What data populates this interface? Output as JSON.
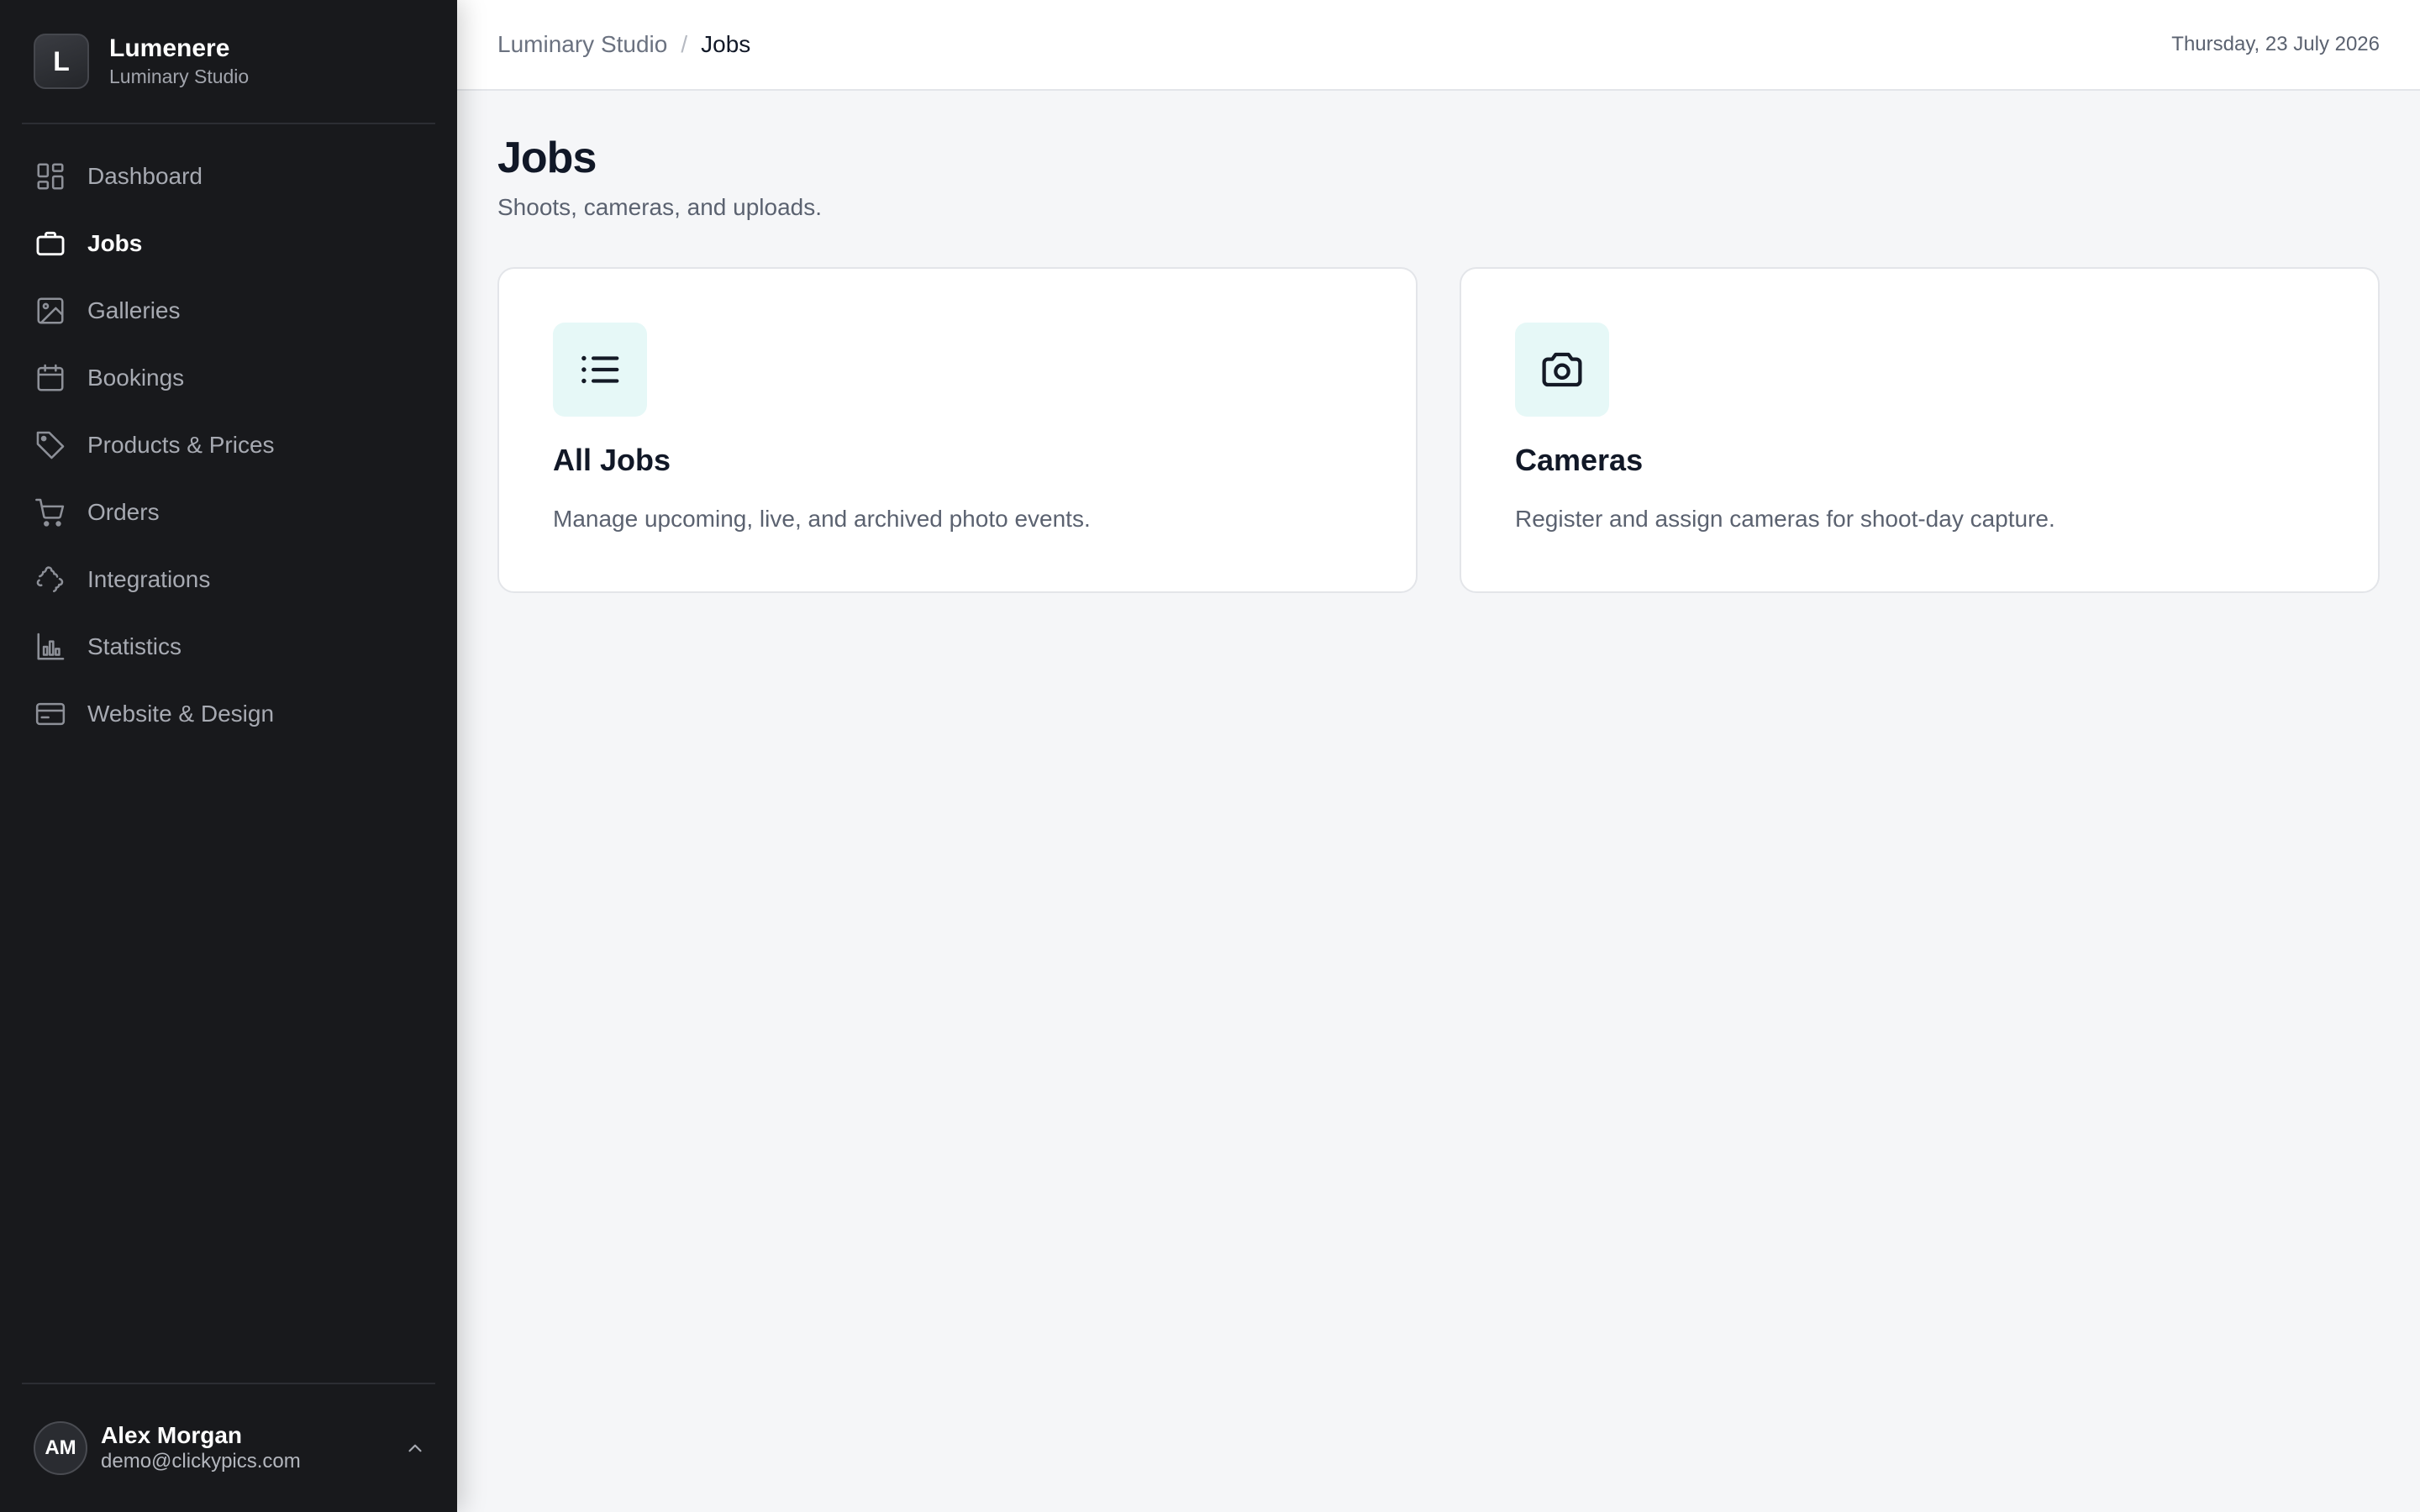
{
  "brand": {
    "logo_letter": "L",
    "name": "Lumenere",
    "subtitle": "Luminary Studio"
  },
  "sidebar": {
    "items": [
      {
        "label": "Dashboard",
        "icon": "dashboard-icon",
        "active": false
      },
      {
        "label": "Jobs",
        "icon": "briefcase-icon",
        "active": true
      },
      {
        "label": "Galleries",
        "icon": "image-icon",
        "active": false
      },
      {
        "label": "Bookings",
        "icon": "calendar-icon",
        "active": false
      },
      {
        "label": "Products & Prices",
        "icon": "tag-icon",
        "active": false
      },
      {
        "label": "Orders",
        "icon": "cart-icon",
        "active": false
      },
      {
        "label": "Integrations",
        "icon": "puzzle-icon",
        "active": false
      },
      {
        "label": "Statistics",
        "icon": "bar-chart-icon",
        "active": false
      },
      {
        "label": "Website & Design",
        "icon": "card-icon",
        "active": false
      }
    ]
  },
  "user": {
    "initials": "AM",
    "name": "Alex Morgan",
    "email": "demo@clickypics.com"
  },
  "header": {
    "breadcrumb_root": "Luminary Studio",
    "breadcrumb_separator": "/",
    "breadcrumb_current": "Jobs",
    "date": "Thursday, 23 July 2026"
  },
  "page": {
    "title": "Jobs",
    "subtitle": "Shoots, cameras, and uploads."
  },
  "cards": [
    {
      "title": "All Jobs",
      "description": "Manage upcoming, live, and archived photo events.",
      "icon": "list-icon"
    },
    {
      "title": "Cameras",
      "description": "Register and assign cameras for shoot-day capture.",
      "icon": "camera-icon"
    }
  ],
  "colors": {
    "sidebar_bg": "#18191c",
    "main_bg": "#f5f6f8",
    "card_icon_bg": "#e6f8f7",
    "text_primary": "#111827",
    "text_secondary": "#5b6270"
  }
}
